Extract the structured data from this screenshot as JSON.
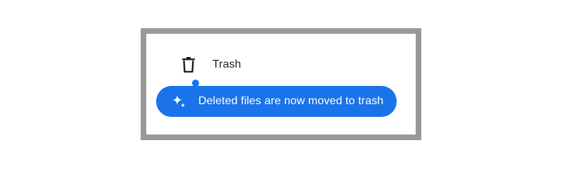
{
  "nav": {
    "trash_label": "Trash",
    "trash_icon": "trash-icon",
    "indicator_color": "#1a73e8"
  },
  "toast": {
    "message": "Deleted files are now moved to trash",
    "icon": "sparkle-icon",
    "background": "#1a73e8",
    "text_color": "#ffffff"
  },
  "frame": {
    "border_color": "#999999"
  }
}
